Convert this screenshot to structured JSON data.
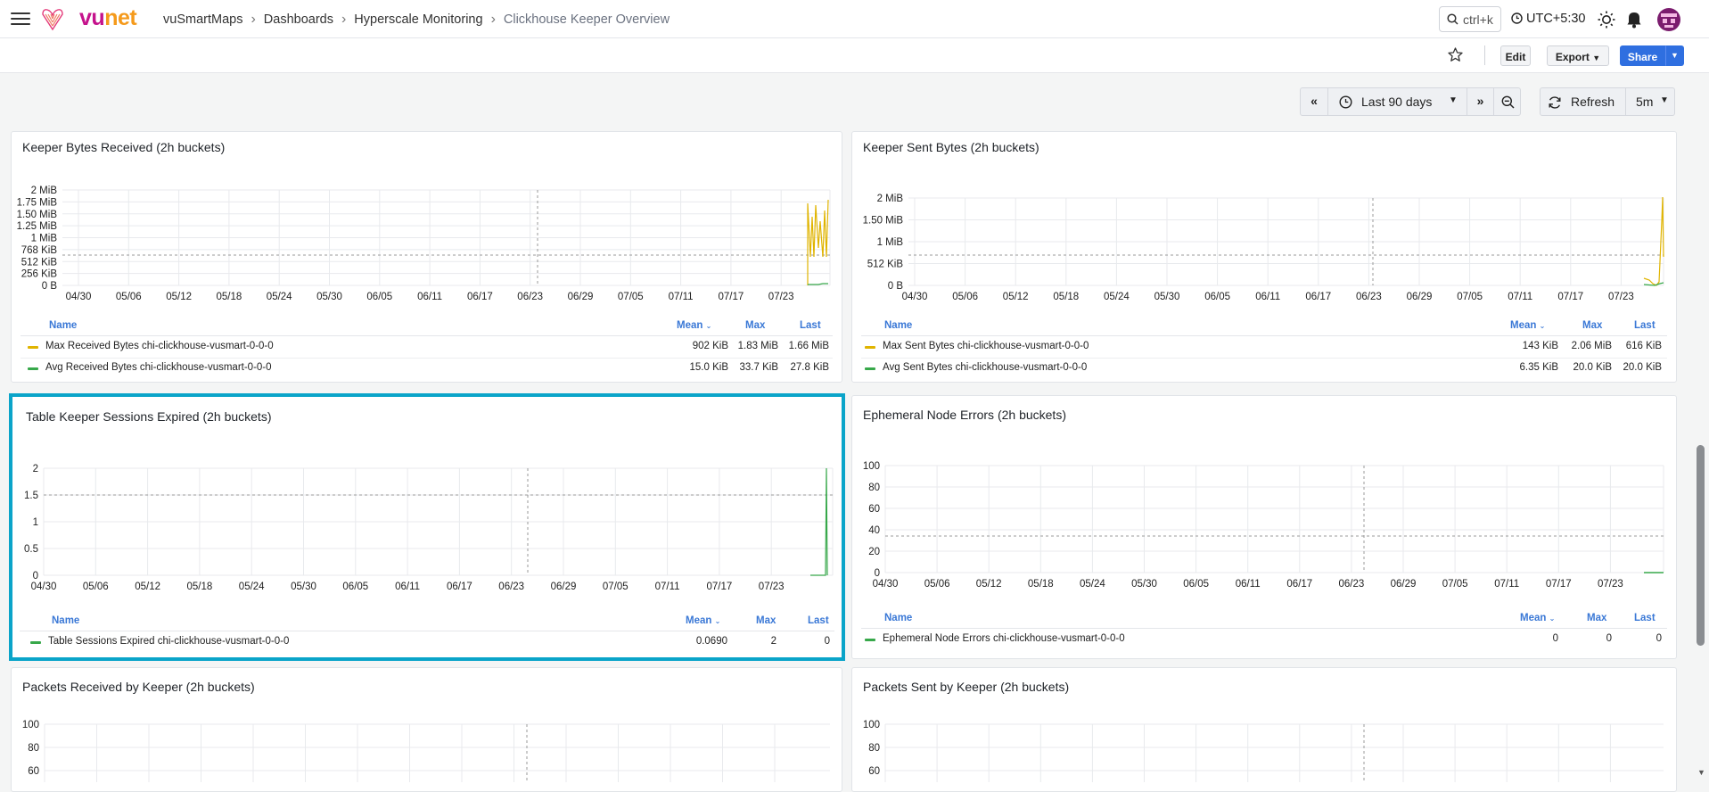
{
  "header": {
    "brand_v": "vu",
    "brand_n": "net",
    "breadcrumb": [
      "vuSmartMaps",
      "Dashboards",
      "Hyperscale Monitoring",
      "Clickhouse Keeper Overview"
    ],
    "search_label": "ctrl+k",
    "timezone": "UTC+5:30"
  },
  "toolbar": {
    "edit": "Edit",
    "export": "Export",
    "share": "Share",
    "time_range": "Last 90 days",
    "refresh": "Refresh",
    "interval": "5m"
  },
  "legend_headers": {
    "name": "Name",
    "mean": "Mean",
    "max": "Max",
    "last": "Last"
  },
  "x_ticks": [
    "04/30",
    "05/06",
    "05/12",
    "05/18",
    "05/24",
    "05/30",
    "06/05",
    "06/11",
    "06/17",
    "06/23",
    "06/29",
    "07/05",
    "07/11",
    "07/17",
    "07/23"
  ],
  "colors": {
    "yellow": "#e0b400",
    "green": "#37a84a",
    "accent": "#0aa4c9",
    "primary": "#2f6fe0"
  },
  "panels": [
    {
      "title": "Keeper Bytes Received (2h buckets)",
      "y_ticks": [
        "2 MiB",
        "1.75 MiB",
        "1.50 MiB",
        "1.25 MiB",
        "1 MiB",
        "768 KiB",
        "512 KiB",
        "256 KiB",
        "0 B"
      ],
      "rows": [
        {
          "name": "Max Received Bytes chi-clickhouse-vusmart-0-0-0",
          "mean": "902 KiB",
          "max": "1.83 MiB",
          "last": "1.66 MiB"
        },
        {
          "name": "Avg Received Bytes chi-clickhouse-vusmart-0-0-0",
          "mean": "15.0 KiB",
          "max": "33.7 KiB",
          "last": "27.8 KiB"
        }
      ]
    },
    {
      "title": "Keeper Sent Bytes (2h buckets)",
      "y_ticks": [
        "2 MiB",
        "1.50 MiB",
        "1 MiB",
        "512 KiB",
        "0 B"
      ],
      "rows": [
        {
          "name": "Max Sent Bytes chi-clickhouse-vusmart-0-0-0",
          "mean": "143 KiB",
          "max": "2.06 MiB",
          "last": "616 KiB"
        },
        {
          "name": "Avg Sent Bytes chi-clickhouse-vusmart-0-0-0",
          "mean": "6.35 KiB",
          "max": "20.0 KiB",
          "last": "20.0 KiB"
        }
      ]
    },
    {
      "title": "Table Keeper Sessions Expired (2h buckets)",
      "y_ticks": [
        "2",
        "1.5",
        "1",
        "0.5",
        "0"
      ],
      "rows": [
        {
          "name": "Table Sessions Expired chi-clickhouse-vusmart-0-0-0",
          "mean": "0.0690",
          "max": "2",
          "last": "0"
        }
      ]
    },
    {
      "title": "Ephemeral Node Errors (2h buckets)",
      "y_ticks": [
        "100",
        "80",
        "60",
        "40",
        "20",
        "0"
      ],
      "rows": [
        {
          "name": "Ephemeral Node Errors chi-clickhouse-vusmart-0-0-0",
          "mean": "0",
          "max": "0",
          "last": "0"
        }
      ]
    },
    {
      "title": "Packets Received by Keeper (2h buckets)",
      "y_ticks": [
        "100",
        "80",
        "60"
      ]
    },
    {
      "title": "Packets Sent by Keeper (2h buckets)",
      "y_ticks": [
        "100",
        "80",
        "60"
      ]
    }
  ]
}
